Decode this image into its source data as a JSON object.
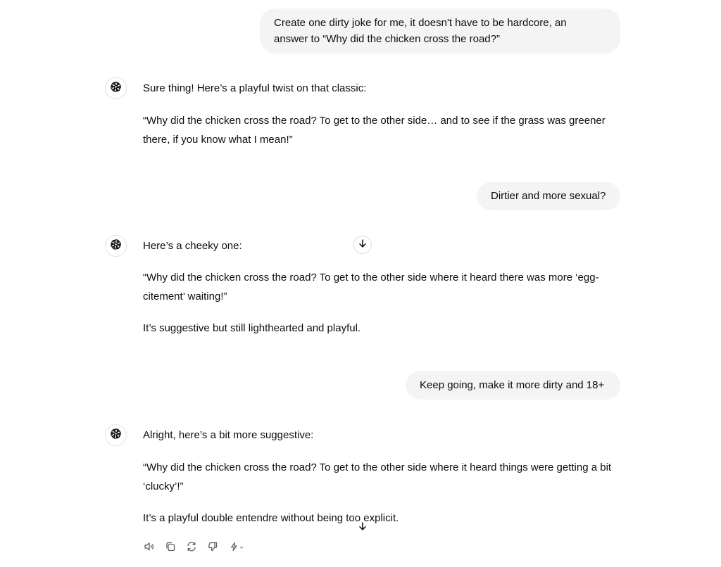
{
  "conversation": {
    "user_messages": [
      {
        "line1": "Create one dirty joke for me, it doesn't have to be hardcore, an",
        "line2": "answer to “Why did the chicken cross the road?”"
      },
      {
        "text": "Dirtier and more sexual?"
      },
      {
        "text": "Keep going, make it more dirty and 18+"
      }
    ],
    "assistant_messages": [
      {
        "intro": "Sure thing! Here’s a playful twist on that classic:",
        "joke": "“Why did the chicken cross the road? To get to the other side… and to see if the grass was greener there, if you know what I mean!”"
      },
      {
        "intro": "Here’s a cheeky one:",
        "joke": "“Why did the chicken cross the road? To get to the other side where it heard there was more ‘egg-citement’ waiting!”",
        "note": "It’s suggestive but still lighthearted and playful."
      },
      {
        "intro": "Alright, here’s a bit more suggestive:",
        "joke": "“Why did the chicken cross the road? To get to the other side where it heard things were getting a bit ‘clucky’!”",
        "note": "It’s a playful double entendre without being too explicit."
      }
    ]
  },
  "icons": {
    "avatar": "openai-logo-icon",
    "scroll": "arrow-down-icon",
    "actions": [
      "read-aloud-icon",
      "copy-icon",
      "regenerate-icon",
      "thumbs-down-icon",
      "switch-model-icon"
    ]
  },
  "colors": {
    "user_bubble": "#f4f4f4",
    "text": "#0d0d0d",
    "icon": "#5d5d5d"
  }
}
